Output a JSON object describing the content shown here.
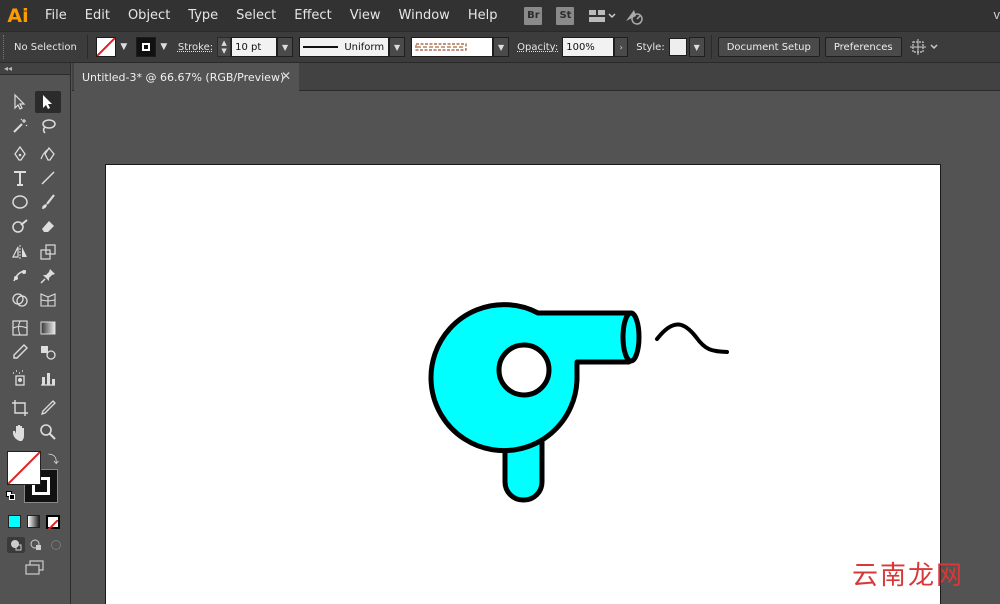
{
  "app": {
    "logo": "Ai",
    "name": "Adobe Illustrator"
  },
  "menu": {
    "items": [
      "File",
      "Edit",
      "Object",
      "Type",
      "Select",
      "Effect",
      "View",
      "Window",
      "Help"
    ],
    "bridge": "Br",
    "stock": "St",
    "right_glyph": "v"
  },
  "control": {
    "selection": "No Selection",
    "stroke_label": "Stroke:",
    "stroke_value": "10 pt",
    "profile": "Uniform",
    "opacity_label": "Opacity:",
    "opacity_value": "100%",
    "style_label": "Style:",
    "document_setup": "Document Setup",
    "preferences": "Preferences"
  },
  "toolbar": {
    "collapse_glyph": "◂◂"
  },
  "document": {
    "tab_title": "Untitled-3* @ 66.67% (RGB/Preview)",
    "close_glyph": "✕"
  },
  "artwork": {
    "fill_color": "#00ffff",
    "stroke_color": "#000000"
  },
  "colors": {
    "accent": "#ff9a00",
    "fill_swatch": "#00ffff"
  },
  "watermark": "云南龙网"
}
